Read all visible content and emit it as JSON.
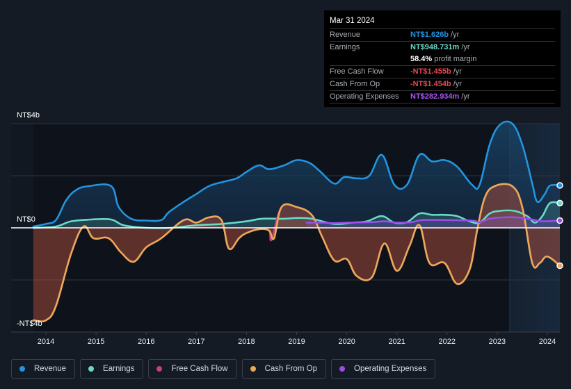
{
  "tooltip": {
    "date": "Mar 31 2024",
    "rows": [
      {
        "label": "Revenue",
        "value": "NT$1.626b",
        "unit": "/yr",
        "color": "#2394df"
      },
      {
        "label": "Earnings",
        "value": "NT$948.731m",
        "unit": "/yr",
        "color": "#6ad9c7"
      },
      {
        "label": "",
        "value": "58.4%",
        "unit": "profit margin",
        "color": "#ffffff"
      },
      {
        "label": "Free Cash Flow",
        "value": "-NT$1.455b",
        "unit": "/yr",
        "color": "#e5484d"
      },
      {
        "label": "Cash From Op",
        "value": "-NT$1.454b",
        "unit": "/yr",
        "color": "#e5484d"
      },
      {
        "label": "Operating Expenses",
        "value": "NT$282.934m",
        "unit": "/yr",
        "color": "#a855f7"
      }
    ]
  },
  "legend": [
    {
      "label": "Revenue",
      "color": "#2394df"
    },
    {
      "label": "Earnings",
      "color": "#6ad9c7"
    },
    {
      "label": "Free Cash Flow",
      "color": "#c4417b"
    },
    {
      "label": "Cash From Op",
      "color": "#e9a958"
    },
    {
      "label": "Operating Expenses",
      "color": "#9b4de8"
    }
  ],
  "chart_data": {
    "type": "area",
    "title": "",
    "xlabel": "",
    "ylabel": "",
    "currency": "NT$",
    "ylim": [
      -4,
      4
    ],
    "yunit": "billions",
    "y_tick_labels": [
      {
        "value": 4,
        "label": "NT$4b"
      },
      {
        "value": 0,
        "label": "NT$0"
      },
      {
        "value": -4,
        "label": "-NT$4b"
      }
    ],
    "xlim": [
      2013.75,
      2024.25
    ],
    "x_ticks": [
      "2014",
      "2015",
      "2016",
      "2017",
      "2018",
      "2019",
      "2020",
      "2021",
      "2022",
      "2023",
      "2024"
    ],
    "highlight_from": 2023.25,
    "grid": true,
    "legend_position": "bottom",
    "series": [
      {
        "name": "Revenue",
        "color": "#2394df",
        "points": [
          [
            2013.75,
            0.05
          ],
          [
            2014.0,
            0.15
          ],
          [
            2014.2,
            0.3
          ],
          [
            2014.4,
            1.05
          ],
          [
            2014.6,
            1.45
          ],
          [
            2014.85,
            1.6
          ],
          [
            2015.3,
            1.6
          ],
          [
            2015.45,
            0.8
          ],
          [
            2015.7,
            0.35
          ],
          [
            2016.0,
            0.28
          ],
          [
            2016.3,
            0.3
          ],
          [
            2016.45,
            0.6
          ],
          [
            2016.75,
            1.0
          ],
          [
            2017.0,
            1.3
          ],
          [
            2017.25,
            1.6
          ],
          [
            2017.5,
            1.75
          ],
          [
            2017.8,
            1.9
          ],
          [
            2018.0,
            2.15
          ],
          [
            2018.25,
            2.4
          ],
          [
            2018.45,
            2.25
          ],
          [
            2018.75,
            2.4
          ],
          [
            2019.0,
            2.6
          ],
          [
            2019.25,
            2.5
          ],
          [
            2019.45,
            2.2
          ],
          [
            2019.75,
            1.7
          ],
          [
            2019.95,
            1.95
          ],
          [
            2020.2,
            1.9
          ],
          [
            2020.45,
            2.0
          ],
          [
            2020.7,
            2.8
          ],
          [
            2020.95,
            1.65
          ],
          [
            2021.2,
            1.65
          ],
          [
            2021.45,
            2.8
          ],
          [
            2021.7,
            2.55
          ],
          [
            2021.95,
            2.6
          ],
          [
            2022.2,
            2.35
          ],
          [
            2022.5,
            1.65
          ],
          [
            2022.65,
            1.65
          ],
          [
            2022.85,
            3.2
          ],
          [
            2023.05,
            3.95
          ],
          [
            2023.3,
            4.0
          ],
          [
            2023.5,
            3.2
          ],
          [
            2023.7,
            1.7
          ],
          [
            2023.8,
            1.0
          ],
          [
            2023.95,
            1.3
          ],
          [
            2024.05,
            1.62
          ],
          [
            2024.25,
            1.63
          ]
        ]
      },
      {
        "name": "Earnings",
        "color": "#6ad9c7",
        "points": [
          [
            2013.75,
            0.0
          ],
          [
            2014.2,
            0.05
          ],
          [
            2014.5,
            0.25
          ],
          [
            2014.9,
            0.32
          ],
          [
            2015.3,
            0.32
          ],
          [
            2015.55,
            0.1
          ],
          [
            2016.0,
            0.0
          ],
          [
            2016.5,
            0.0
          ],
          [
            2017.0,
            0.1
          ],
          [
            2017.5,
            0.15
          ],
          [
            2018.0,
            0.25
          ],
          [
            2018.3,
            0.35
          ],
          [
            2018.75,
            0.35
          ],
          [
            2019.0,
            0.38
          ],
          [
            2019.3,
            0.35
          ],
          [
            2019.75,
            0.15
          ],
          [
            2020.1,
            0.2
          ],
          [
            2020.4,
            0.25
          ],
          [
            2020.7,
            0.45
          ],
          [
            2020.95,
            0.2
          ],
          [
            2021.2,
            0.22
          ],
          [
            2021.45,
            0.55
          ],
          [
            2021.7,
            0.5
          ],
          [
            2021.95,
            0.5
          ],
          [
            2022.2,
            0.45
          ],
          [
            2022.45,
            0.25
          ],
          [
            2022.65,
            0.2
          ],
          [
            2022.85,
            0.55
          ],
          [
            2023.05,
            0.65
          ],
          [
            2023.35,
            0.65
          ],
          [
            2023.6,
            0.45
          ],
          [
            2023.75,
            0.2
          ],
          [
            2023.9,
            0.45
          ],
          [
            2024.05,
            0.95
          ],
          [
            2024.25,
            0.95
          ]
        ]
      },
      {
        "name": "Free Cash Flow",
        "color": "#c4417b",
        "points": [
          [
            2013.75,
            -3.55
          ],
          [
            2014.0,
            -3.55
          ],
          [
            2014.2,
            -3.0
          ],
          [
            2014.5,
            -1.0
          ],
          [
            2014.75,
            0.05
          ],
          [
            2014.95,
            -0.4
          ],
          [
            2015.25,
            -0.4
          ],
          [
            2015.5,
            -0.95
          ],
          [
            2015.75,
            -1.3
          ],
          [
            2016.0,
            -0.75
          ],
          [
            2016.3,
            -0.4
          ],
          [
            2016.75,
            0.3
          ],
          [
            2017.0,
            0.2
          ],
          [
            2017.25,
            0.4
          ],
          [
            2017.5,
            0.3
          ],
          [
            2017.65,
            -0.8
          ],
          [
            2017.85,
            -0.4
          ],
          [
            2018.0,
            -0.2
          ],
          [
            2018.25,
            -0.05
          ],
          [
            2018.45,
            -0.1
          ],
          [
            2018.5,
            -0.45
          ],
          [
            2018.7,
            0.8
          ],
          [
            2019.0,
            0.8
          ],
          [
            2019.3,
            0.5
          ],
          [
            2019.5,
            -0.3
          ],
          [
            2019.75,
            -1.25
          ],
          [
            2020.0,
            -1.2
          ],
          [
            2020.2,
            -1.85
          ],
          [
            2020.5,
            -1.9
          ],
          [
            2020.75,
            -0.6
          ],
          [
            2021.0,
            -1.65
          ],
          [
            2021.25,
            -0.7
          ],
          [
            2021.45,
            0.1
          ],
          [
            2021.65,
            -1.35
          ],
          [
            2021.95,
            -1.35
          ],
          [
            2022.2,
            -2.15
          ],
          [
            2022.45,
            -1.6
          ],
          [
            2022.6,
            -0.1
          ],
          [
            2022.75,
            1.15
          ],
          [
            2022.95,
            1.6
          ],
          [
            2023.3,
            1.6
          ],
          [
            2023.5,
            0.8
          ],
          [
            2023.7,
            -1.35
          ],
          [
            2023.85,
            -1.35
          ],
          [
            2024.0,
            -1.1
          ],
          [
            2024.25,
            -1.455
          ]
        ]
      },
      {
        "name": "Cash From Op",
        "color": "#e9a958",
        "points": [
          [
            2013.75,
            -3.55
          ],
          [
            2014.0,
            -3.55
          ],
          [
            2014.2,
            -3.0
          ],
          [
            2014.5,
            -1.0
          ],
          [
            2014.75,
            0.05
          ],
          [
            2014.95,
            -0.4
          ],
          [
            2015.25,
            -0.4
          ],
          [
            2015.5,
            -0.95
          ],
          [
            2015.75,
            -1.3
          ],
          [
            2016.0,
            -0.75
          ],
          [
            2016.3,
            -0.4
          ],
          [
            2016.75,
            0.3
          ],
          [
            2017.0,
            0.2
          ],
          [
            2017.25,
            0.4
          ],
          [
            2017.5,
            0.3
          ],
          [
            2017.65,
            -0.8
          ],
          [
            2017.85,
            -0.4
          ],
          [
            2018.0,
            -0.2
          ],
          [
            2018.25,
            -0.05
          ],
          [
            2018.45,
            -0.1
          ],
          [
            2018.55,
            -0.4
          ],
          [
            2018.7,
            0.8
          ],
          [
            2019.0,
            0.8
          ],
          [
            2019.3,
            0.5
          ],
          [
            2019.5,
            -0.3
          ],
          [
            2019.75,
            -1.25
          ],
          [
            2020.0,
            -1.2
          ],
          [
            2020.2,
            -1.85
          ],
          [
            2020.5,
            -1.9
          ],
          [
            2020.75,
            -0.6
          ],
          [
            2021.0,
            -1.65
          ],
          [
            2021.25,
            -0.7
          ],
          [
            2021.45,
            0.1
          ],
          [
            2021.65,
            -1.35
          ],
          [
            2021.95,
            -1.35
          ],
          [
            2022.2,
            -2.15
          ],
          [
            2022.45,
            -1.6
          ],
          [
            2022.6,
            -0.1
          ],
          [
            2022.75,
            1.15
          ],
          [
            2022.95,
            1.6
          ],
          [
            2023.3,
            1.6
          ],
          [
            2023.5,
            0.8
          ],
          [
            2023.7,
            -1.35
          ],
          [
            2023.85,
            -1.35
          ],
          [
            2024.0,
            -1.1
          ],
          [
            2024.25,
            -1.454
          ]
        ]
      },
      {
        "name": "Operating Expenses",
        "color": "#9b4de8",
        "points": [
          [
            2019.2,
            0.2
          ],
          [
            2019.5,
            0.2
          ],
          [
            2019.75,
            0.18
          ],
          [
            2020.0,
            0.2
          ],
          [
            2020.5,
            0.22
          ],
          [
            2020.75,
            0.25
          ],
          [
            2021.0,
            0.2
          ],
          [
            2021.3,
            0.22
          ],
          [
            2021.5,
            0.3
          ],
          [
            2022.0,
            0.3
          ],
          [
            2022.5,
            0.28
          ],
          [
            2022.65,
            0.22
          ],
          [
            2022.85,
            0.35
          ],
          [
            2023.1,
            0.4
          ],
          [
            2023.4,
            0.4
          ],
          [
            2023.7,
            0.32
          ],
          [
            2023.9,
            0.25
          ],
          [
            2024.25,
            0.28
          ]
        ]
      }
    ]
  }
}
